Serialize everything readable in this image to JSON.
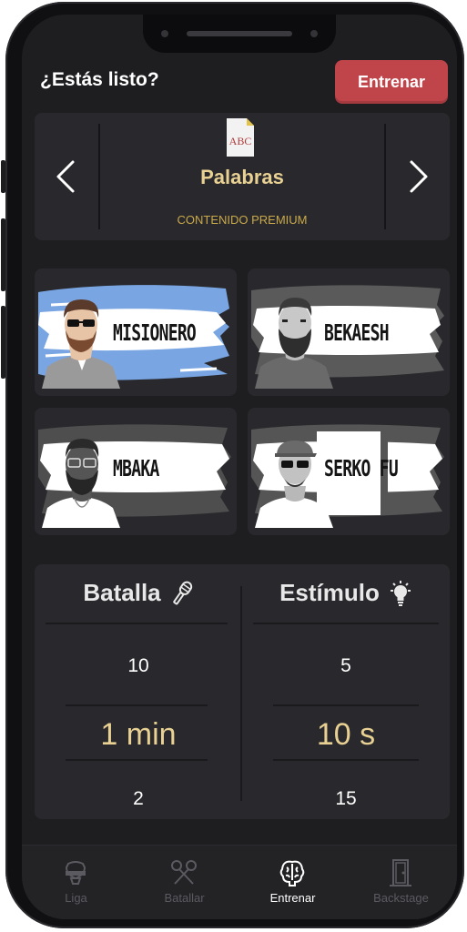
{
  "header": {
    "title": "¿Estás listo?",
    "train_button": "Entrenar"
  },
  "mode_selector": {
    "icon": "abc-document-icon",
    "icon_text": "ABC",
    "name": "Palabras",
    "subtitle": "CONTENIDO PREMIUM",
    "prev_icon": "chevron-left-icon",
    "next_icon": "chevron-right-icon"
  },
  "rappers": [
    {
      "name": "MISIONERO",
      "flag_colors": [
        "#79a6e3",
        "#ffffff"
      ]
    },
    {
      "name": "BEKAESH",
      "flag_colors": [
        "#5a5a5a",
        "#ffffff"
      ]
    },
    {
      "name": "MBAKA",
      "flag_colors": [
        "#4e4e4e",
        "#ffffff"
      ]
    },
    {
      "name": "SERKO FU",
      "flag_colors": [
        "#555555",
        "#ffffff"
      ]
    }
  ],
  "settings": {
    "battle": {
      "title": "Batalla",
      "icon": "microphone-icon",
      "above": "10",
      "selected": "1 min",
      "below": "2"
    },
    "stimulus": {
      "title": "Estímulo",
      "icon": "lightbulb-icon",
      "above": "5",
      "selected": "10 s",
      "below": "15"
    }
  },
  "tabs": [
    {
      "label": "Liga",
      "icon": "trophy-icon",
      "active": false
    },
    {
      "label": "Batallar",
      "icon": "crossed-microphones-icon",
      "active": false
    },
    {
      "label": "Entrenar",
      "icon": "brain-icon",
      "active": true
    },
    {
      "label": "Backstage",
      "icon": "door-icon",
      "active": false
    }
  ],
  "colors": {
    "accent": "#c0454a",
    "gold": "#e8d193",
    "premium": "#c9a94a",
    "background": "#1e1e21",
    "card": "#29292d"
  }
}
